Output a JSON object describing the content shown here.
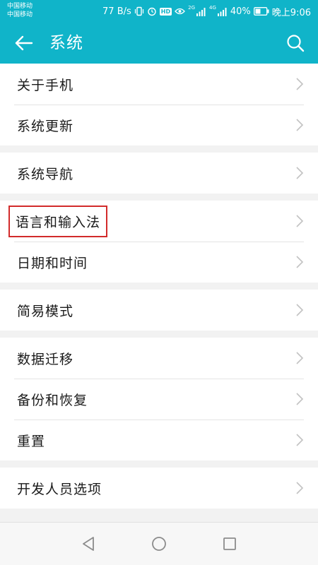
{
  "status_bar": {
    "carrier_1": "中国移动",
    "carrier_2": "中国移动",
    "net_speed": "77 B/s",
    "hd_badge": "HD",
    "network_type_1": "2G",
    "network_type_2": "4G",
    "battery_percent": "40%",
    "time": "晚上9:06",
    "icons": [
      "vibrate-icon",
      "alarm-icon",
      "hd-icon",
      "eye-icon",
      "signal-icon",
      "signal-icon",
      "battery-icon"
    ]
  },
  "app_bar": {
    "title": "系统",
    "back_icon": "arrow-left-icon",
    "search_icon": "search-icon",
    "color": "#10b4c9"
  },
  "settings_groups": [
    {
      "items": [
        {
          "label": "关于手机"
        },
        {
          "label": "系统更新"
        }
      ]
    },
    {
      "items": [
        {
          "label": "系统导航"
        }
      ]
    },
    {
      "items": [
        {
          "label": "语言和输入法",
          "highlighted": true
        },
        {
          "label": "日期和时间"
        }
      ]
    },
    {
      "items": [
        {
          "label": "简易模式"
        }
      ]
    },
    {
      "items": [
        {
          "label": "数据迁移"
        },
        {
          "label": "备份和恢复"
        },
        {
          "label": "重置"
        }
      ]
    },
    {
      "items": [
        {
          "label": "开发人员选项"
        }
      ]
    }
  ],
  "nav_bar": {
    "buttons": [
      "back-triangle-icon",
      "home-circle-icon",
      "recents-square-icon"
    ]
  },
  "colors": {
    "accent": "#10b4c9",
    "highlight_border": "#d22b2b"
  }
}
